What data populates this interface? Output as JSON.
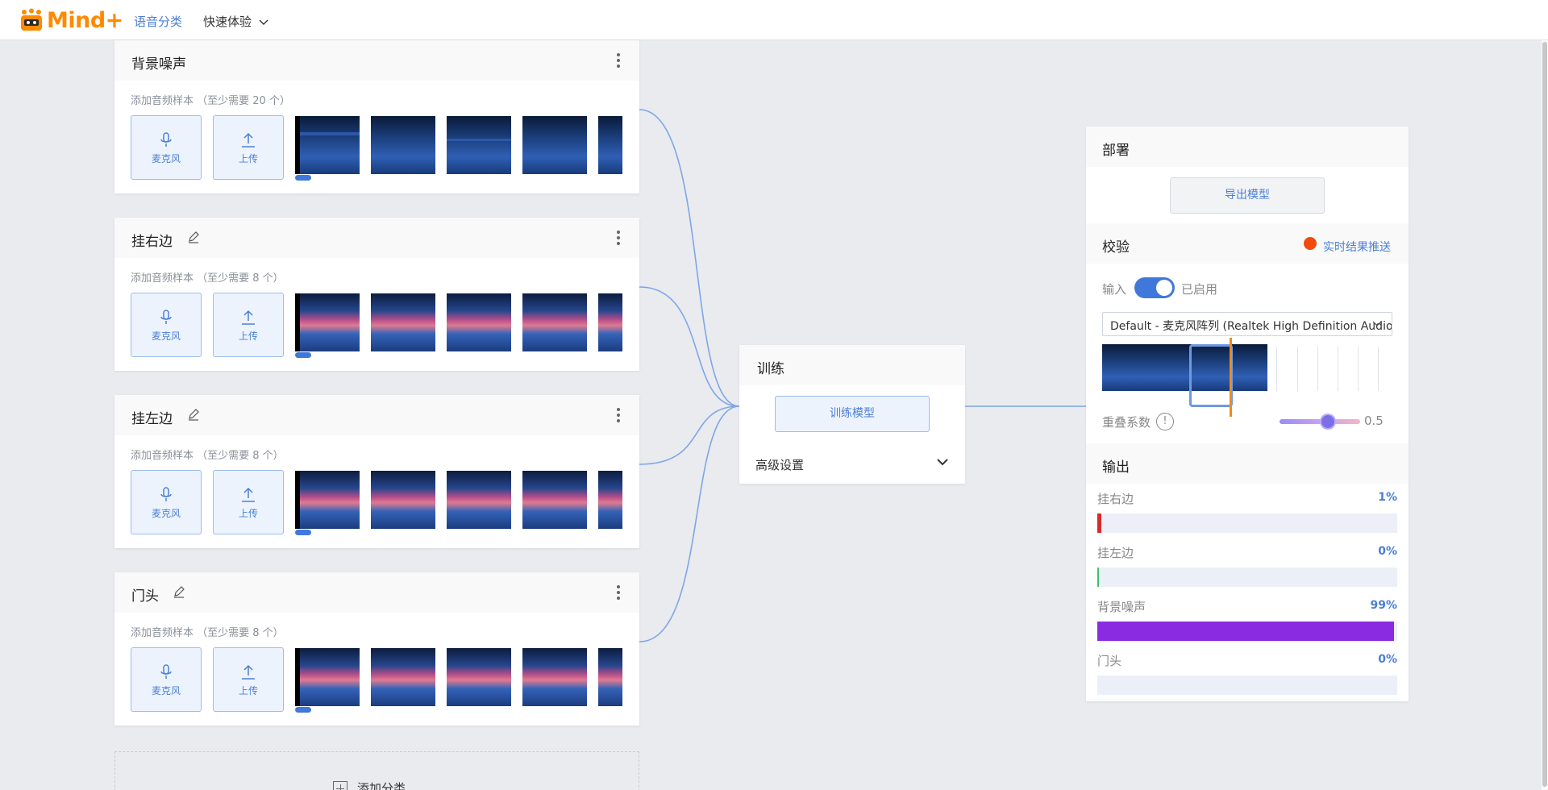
{
  "app": {
    "logo_text": "Mind+",
    "nav": [
      {
        "label": "语音分类",
        "active": true
      },
      {
        "label": "快速体验",
        "active": false
      }
    ]
  },
  "icons": {
    "logo": "robot-logo-icon",
    "mic": "microphone-icon",
    "upload": "upload-icon",
    "edit": "pencil-icon",
    "more": "more-vertical-icon",
    "chevron": "chevron-down-icon",
    "info": "info-icon",
    "plus": "plus-icon"
  },
  "classes": [
    {
      "title": "背景噪声",
      "hint": "添加音频样本 （至少需要 20 个）",
      "editable": false,
      "mic_label": "麦克风",
      "upload_label": "上传"
    },
    {
      "title": "挂右边",
      "hint": "添加音频样本 （至少需要 8 个）",
      "editable": true,
      "mic_label": "麦克风",
      "upload_label": "上传"
    },
    {
      "title": "挂左边",
      "hint": "添加音频样本 （至少需要 8 个）",
      "editable": true,
      "mic_label": "麦克风",
      "upload_label": "上传"
    },
    {
      "title": "门头",
      "hint": "添加音频样本 （至少需要 8 个）",
      "editable": true,
      "mic_label": "麦克风",
      "upload_label": "上传"
    }
  ],
  "add_class_label": "添加分类",
  "training": {
    "title": "训练",
    "train_button": "训练模型",
    "advanced": "高级设置"
  },
  "deploy": {
    "title": "部署",
    "export_button": "导出模型",
    "verify_title": "校验",
    "realtime_push": "实时结果推送",
    "input_label": "输入",
    "input_enabled": true,
    "enabled_text": "已启用",
    "device": "Default - 麦克风阵列 (Realtek High Definition Audio)",
    "overlap_label": "重叠系数",
    "overlap_value": "0.5",
    "overlap_fraction": 0.5,
    "output_title": "输出",
    "outputs": [
      {
        "label": "挂右边",
        "value": "1%",
        "fraction": 0.01,
        "color": "#d62b2b"
      },
      {
        "label": "挂左边",
        "value": "0%",
        "fraction": 0.0,
        "color": "#3fbf6a"
      },
      {
        "label": "背景噪声",
        "value": "99%",
        "fraction": 0.99,
        "color": "#8a2be2"
      },
      {
        "label": "门头",
        "value": "0%",
        "fraction": 0.0,
        "color": "#e8a317"
      }
    ]
  },
  "colors": {
    "accent": "#3f78da",
    "logo": "#ff8a00",
    "realtime_dot": "#f2490c"
  }
}
